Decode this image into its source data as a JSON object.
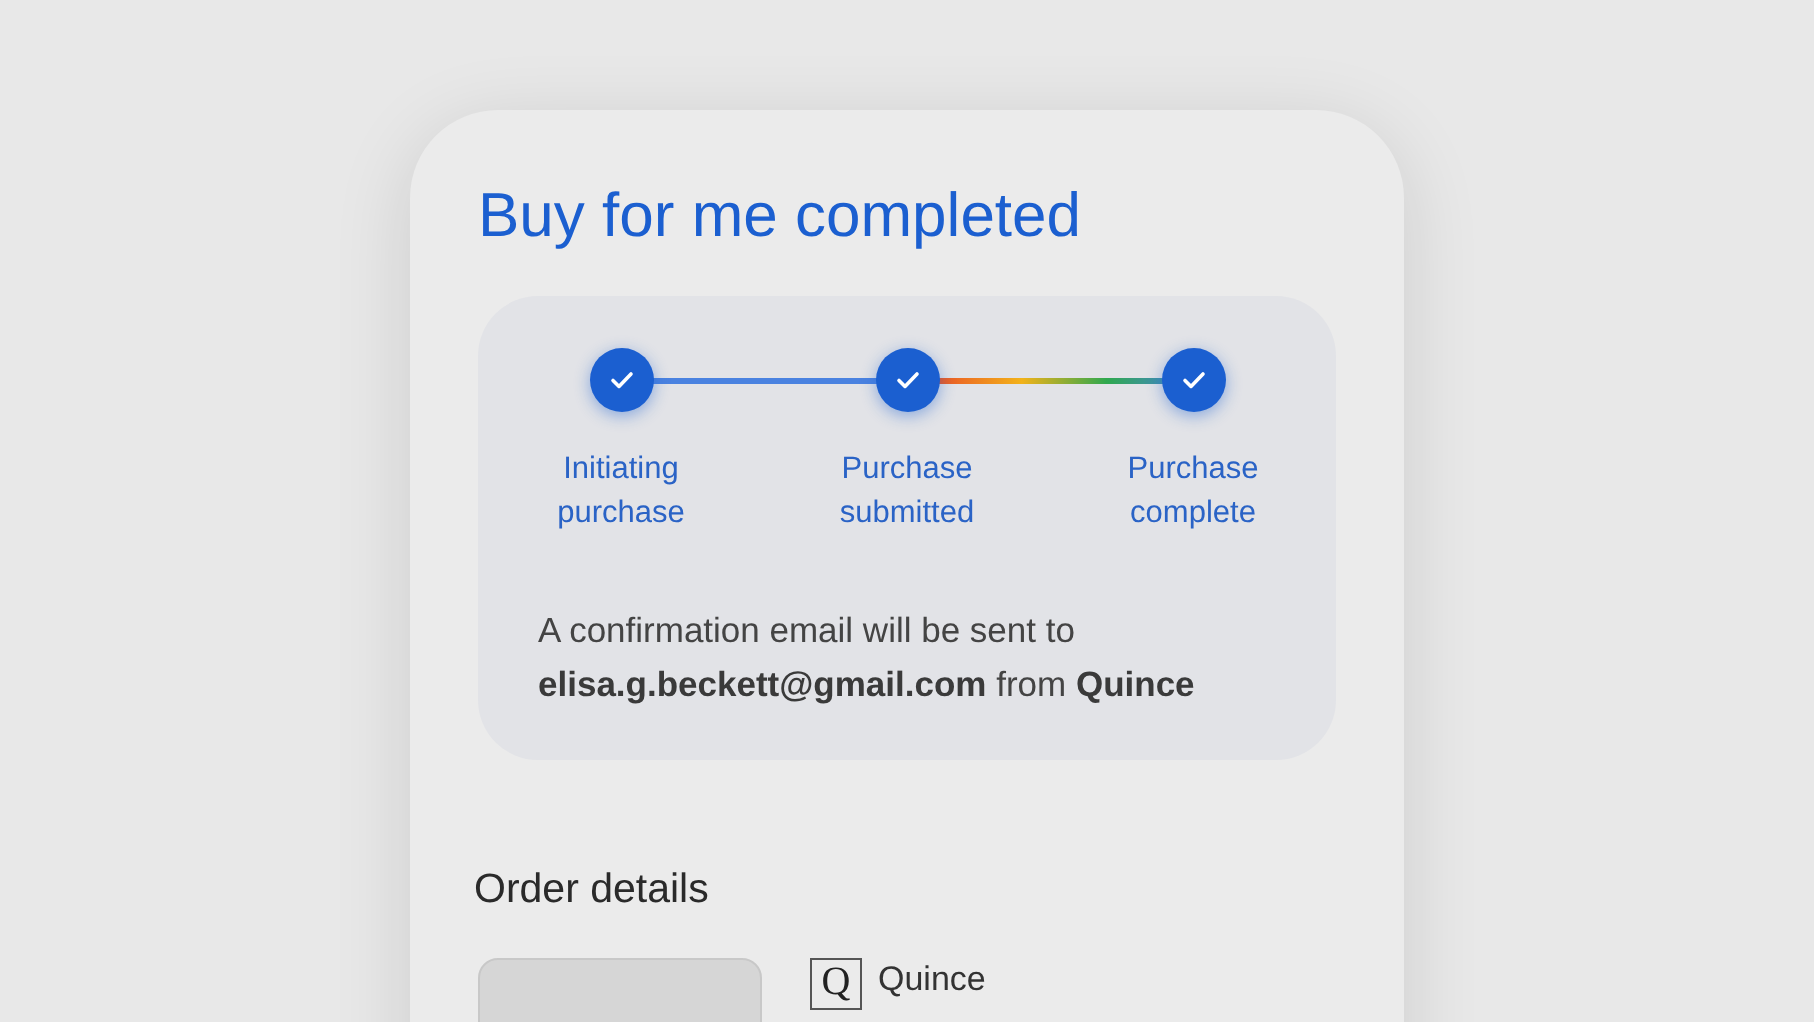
{
  "title": "Buy for me completed",
  "steps": [
    {
      "label": "Initiating purchase",
      "done": true
    },
    {
      "label": "Purchase submitted",
      "done": true
    },
    {
      "label": "Purchase complete",
      "done": true
    }
  ],
  "connectors": [
    {
      "kind": "solid"
    },
    {
      "kind": "gradient"
    }
  ],
  "message": "A confirmation email will be sent to **elisa.g.beckett@gmail.com** from **Quince**",
  "order_details": {
    "heading": "Order details",
    "merchant_logo": "Q",
    "merchant": "Quince"
  }
}
